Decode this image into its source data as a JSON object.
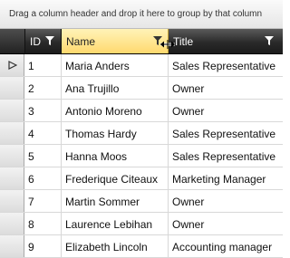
{
  "group_panel": {
    "hint": "Drag a column header and drop it here to group by that column"
  },
  "columns": [
    {
      "key": "id",
      "label": "ID"
    },
    {
      "key": "name",
      "label": "Name"
    },
    {
      "key": "title",
      "label": "Title"
    }
  ],
  "rows": [
    {
      "id": "1",
      "name": "Maria Anders",
      "title": "Sales Representative"
    },
    {
      "id": "2",
      "name": "Ana Trujillo",
      "title": "Owner"
    },
    {
      "id": "3",
      "name": "Antonio Moreno",
      "title": "Owner"
    },
    {
      "id": "4",
      "name": "Thomas Hardy",
      "title": "Sales Representative"
    },
    {
      "id": "5",
      "name": "Hanna Moos",
      "title": "Sales Representative"
    },
    {
      "id": "6",
      "name": "Frederique Citeaux",
      "title": "Marketing Manager"
    },
    {
      "id": "7",
      "name": "Martin Sommer",
      "title": "Owner"
    },
    {
      "id": "8",
      "name": "Laurence Lebihan",
      "title": "Owner"
    },
    {
      "id": "9",
      "name": "Elizabeth Lincoln",
      "title": "Accounting manager"
    }
  ],
  "current_row_indicator": "row-arrow-icon",
  "colors": {
    "header_dark": "#2a2a2a",
    "header_selected": "#ffd96e",
    "row_border": "#d8d8d8"
  }
}
